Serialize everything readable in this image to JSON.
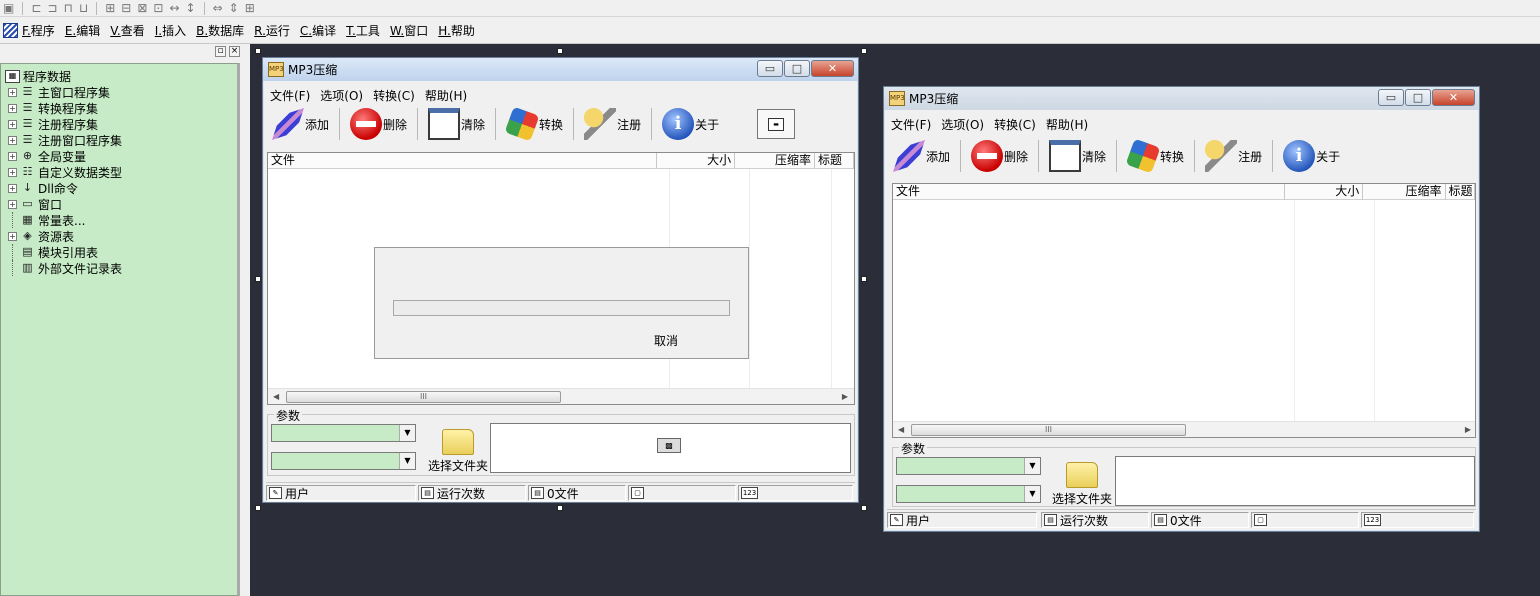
{
  "ide": {
    "menu": [
      {
        "key": "F.",
        "label": "程序"
      },
      {
        "key": "E.",
        "label": "编辑"
      },
      {
        "key": "V.",
        "label": "查看"
      },
      {
        "key": "I.",
        "label": "插入"
      },
      {
        "key": "B.",
        "label": "数据库"
      },
      {
        "key": "R.",
        "label": "运行"
      },
      {
        "key": "C.",
        "label": "编译"
      },
      {
        "key": "T.",
        "label": "工具"
      },
      {
        "key": "W.",
        "label": "窗口"
      },
      {
        "key": "H.",
        "label": "帮助"
      }
    ],
    "panel_buttons": [
      "▫",
      "×"
    ],
    "tree": {
      "root": "程序数据",
      "items": [
        {
          "label": "主窗口程序集",
          "icon": "module-icon",
          "expander": "+"
        },
        {
          "label": "转换程序集",
          "icon": "module-icon",
          "expander": "+"
        },
        {
          "label": "注册程序集",
          "icon": "module-icon",
          "expander": "+"
        },
        {
          "label": "注册窗口程序集",
          "icon": "module-icon",
          "expander": "+"
        },
        {
          "label": "全局变量",
          "icon": "variable-icon",
          "expander": "+"
        },
        {
          "label": "自定义数据类型",
          "icon": "datatype-icon",
          "expander": "+"
        },
        {
          "label": "Dll命令",
          "icon": "dll-icon",
          "expander": "+"
        },
        {
          "label": "窗口",
          "icon": "window-icon",
          "expander": "+"
        },
        {
          "label": "常量表...",
          "icon": "constant-icon",
          "expander": ""
        },
        {
          "label": "资源表",
          "icon": "resource-icon",
          "expander": "+"
        },
        {
          "label": "模块引用表",
          "icon": "module-ref-icon",
          "expander": ""
        },
        {
          "label": "外部文件记录表",
          "icon": "file-record-icon",
          "expander": ""
        }
      ]
    }
  },
  "app": {
    "title": "MP3压缩",
    "icon_text": "MP3",
    "menu": [
      "文件(F)",
      "选项(O)",
      "转换(C)",
      "帮助(H)"
    ],
    "toolbar": {
      "add": "添加",
      "delete": "删除",
      "clear": "清除",
      "convert": "转换",
      "register": "注册",
      "about": "关于",
      "about_glyph": "i"
    },
    "columns": [
      "文件",
      "大小",
      "压缩率",
      "标题"
    ],
    "params_label": "参数",
    "choose_folder": "选择文件夹",
    "status": {
      "user": "用户",
      "runs": "运行次数",
      "files": "0文件"
    },
    "progress": {
      "cancel": "取消",
      "percent": 0
    },
    "scroll_grip": "III",
    "captions": {
      "minimize": "▭",
      "maximize": "□",
      "close": "✕"
    }
  }
}
